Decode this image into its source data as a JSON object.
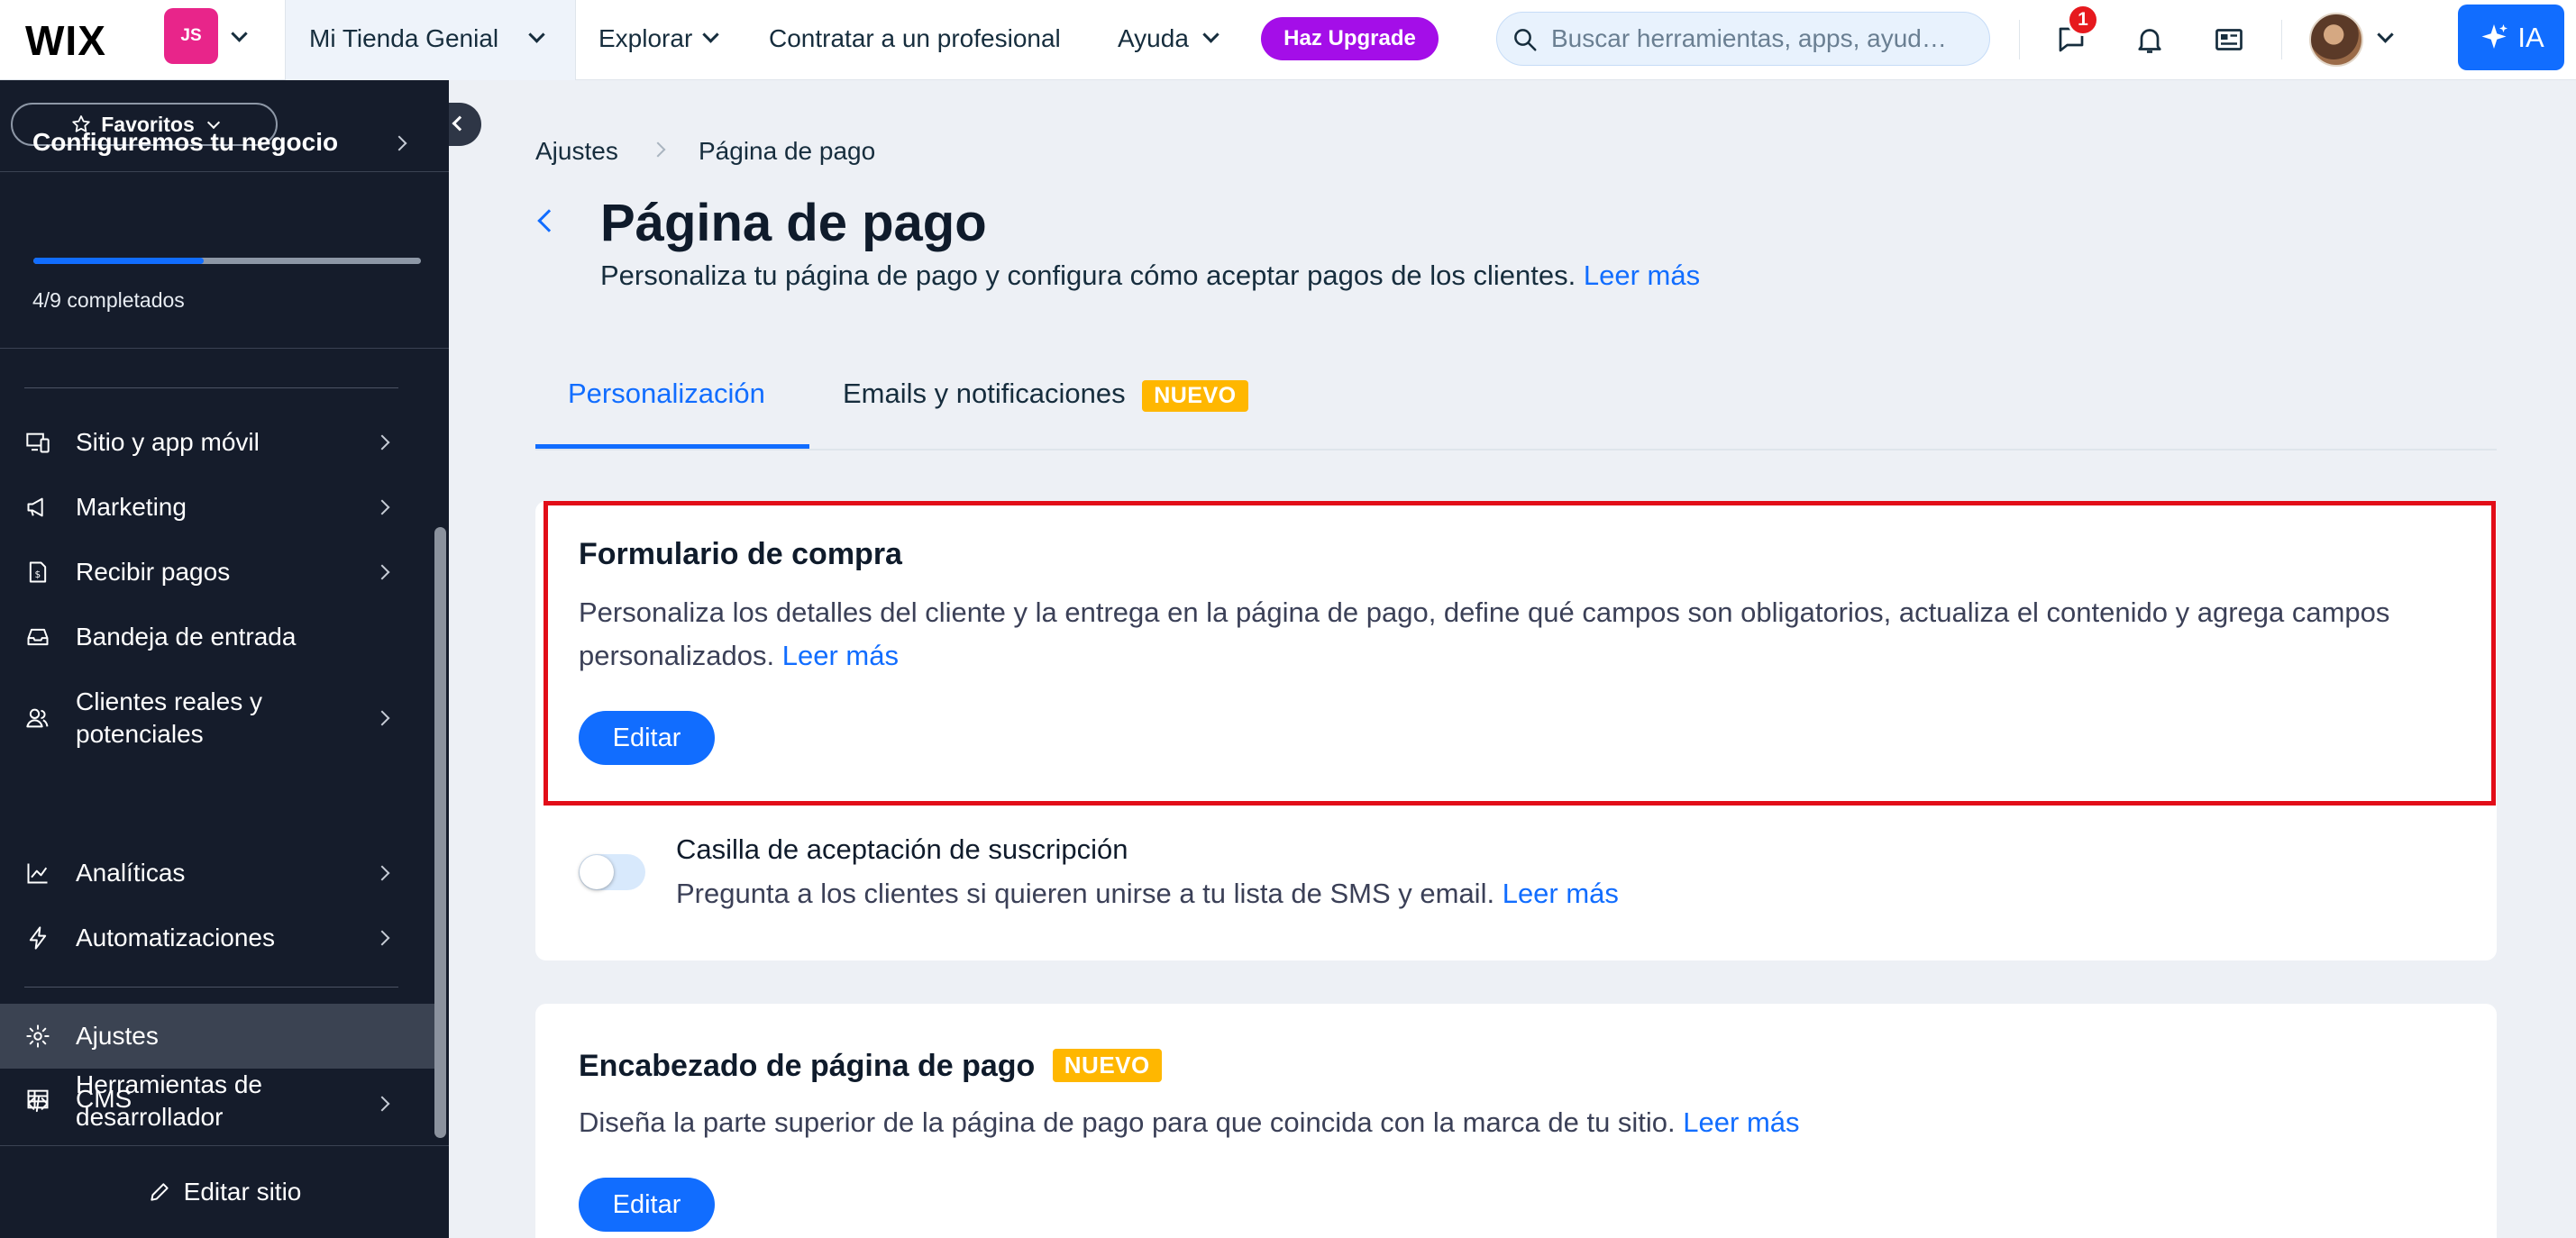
{
  "topbar": {
    "logo": "WIX",
    "account_initials": "JS",
    "site_name": "Mi Tienda Genial",
    "nav": {
      "explore": "Explorar",
      "hire": "Contratar a un profesional",
      "help": "Ayuda"
    },
    "upgrade_label": "Haz Upgrade",
    "search_placeholder": "Buscar herramientas, apps, ayud…",
    "messages_badge": "1",
    "ai_label": "IA"
  },
  "sidebar": {
    "favorites_label": "Favoritos",
    "setup": {
      "title": "Configuremos tu negocio",
      "progress_text": "4/9 completados",
      "progress_fraction": 0.44
    },
    "items": [
      {
        "label": "Sitio y app móvil",
        "icon": "site-mobile-icon"
      },
      {
        "label": "Marketing",
        "icon": "megaphone-icon"
      },
      {
        "label": "Recibir pagos",
        "icon": "payments-icon"
      },
      {
        "label": "Bandeja de entrada",
        "icon": "inbox-icon"
      },
      {
        "label": "Clientes reales y potenciales",
        "icon": "contacts-icon"
      },
      {
        "label": "Analíticas",
        "icon": "analytics-icon"
      },
      {
        "label": "Automatizaciones",
        "icon": "automations-icon"
      },
      {
        "label": "Ajustes",
        "icon": "gear-icon"
      },
      {
        "label": "CMS",
        "icon": "cms-icon"
      },
      {
        "label": "Herramientas de desarrollador",
        "icon": "code-icon"
      }
    ],
    "edit_site_label": "Editar sitio"
  },
  "main": {
    "breadcrumb": {
      "parent": "Ajustes",
      "current": "Página de pago"
    },
    "title": "Página de pago",
    "subtitle": "Personaliza tu página de pago y configura cómo aceptar pagos de los clientes.",
    "subtitle_link": "Leer más",
    "tabs": [
      {
        "label": "Personalización",
        "active": true
      },
      {
        "label": "Emails y notificaciones",
        "badge": "NUEVO"
      }
    ],
    "form_card": {
      "title": "Formulario de compra",
      "desc": "Personaliza los detalles del cliente y la entrega en la página de pago, define qué campos son obligatorios, actualiza el contenido y agrega campos personalizados.",
      "link": "Leer más",
      "button": "Editar",
      "toggle_title": "Casilla de aceptación de suscripción",
      "toggle_desc": "Pregunta a los clientes si quieren unirse a tu lista de SMS y email.",
      "toggle_link": "Leer más",
      "toggle_on": false
    },
    "header_card": {
      "title": "Encabezado de página de pago",
      "badge": "NUEVO",
      "desc": "Diseña la parte superior de la página de pago para que coincida con la marca de tu sitio.",
      "link": "Leer más",
      "button": "Editar"
    }
  },
  "colors": {
    "accent": "#116dff",
    "sidebar_bg": "#151c2b",
    "upgrade": "#a40ee8",
    "highlight": "#e20d18",
    "badge": "#ffb700"
  }
}
